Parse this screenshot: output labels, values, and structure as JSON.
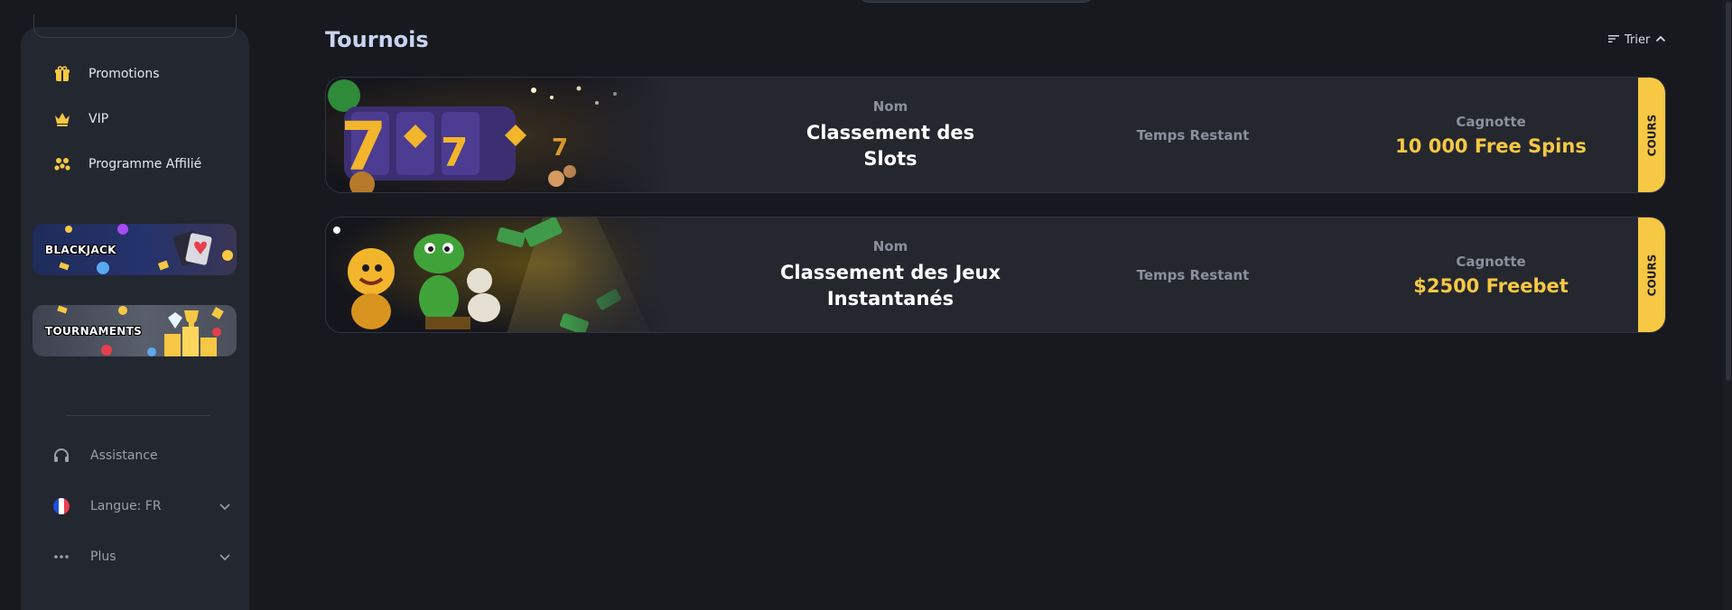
{
  "sidebar": {
    "items": [
      {
        "label": "Promotions",
        "icon": "gift-icon"
      },
      {
        "label": "VIP",
        "icon": "crown-icon"
      },
      {
        "label": "Programme Affilié",
        "icon": "affiliate-icon"
      }
    ],
    "banners": [
      {
        "label": "BLACKJACK"
      },
      {
        "label": "TOURNAMENTS"
      }
    ],
    "bottom": {
      "assistance": "Assistance",
      "language": "Langue: FR",
      "more": "Plus"
    }
  },
  "main": {
    "title": "Tournois",
    "sort_label": "Trier",
    "tournaments": [
      {
        "name_label": "Nom",
        "name": "Classement des Slots",
        "time_label": "Temps Restant",
        "pot_label": "Cagnotte",
        "pot": "10 000 Free Spins",
        "status": "COURS"
      },
      {
        "name_label": "Nom",
        "name": "Classement des Jeux Instantanés",
        "time_label": "Temps Restant",
        "pot_label": "Cagnotte",
        "pot": "$2500 Freebet",
        "status": "COURS"
      }
    ]
  },
  "colors": {
    "accent": "#f7c843",
    "background": "#17191f",
    "sidebar": "#23272f",
    "card": "#25272f"
  }
}
